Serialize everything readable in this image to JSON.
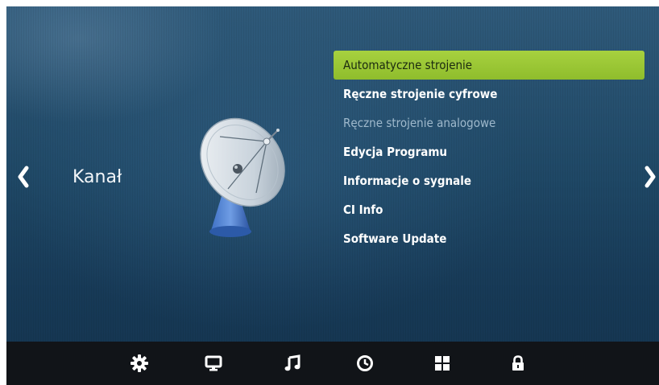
{
  "category": {
    "label": "Kanał"
  },
  "menu": {
    "items": [
      {
        "label": "Automatyczne strojenie",
        "state": "selected"
      },
      {
        "label": "Ręczne strojenie cyfrowe",
        "state": "normal"
      },
      {
        "label": "Ręczne strojenie analogowe",
        "state": "disabled"
      },
      {
        "label": "Edycja Programu",
        "state": "normal"
      },
      {
        "label": "Informacje o sygnale",
        "state": "normal"
      },
      {
        "label": "CI Info",
        "state": "normal"
      },
      {
        "label": "Software Update",
        "state": "normal"
      }
    ]
  },
  "bottom_tabs": [
    {
      "icon": "gear-icon",
      "active": true
    },
    {
      "icon": "monitor-icon",
      "active": false
    },
    {
      "icon": "music-icon",
      "active": false
    },
    {
      "icon": "clock-icon",
      "active": false
    },
    {
      "icon": "grid-icon",
      "active": false
    },
    {
      "icon": "lock-icon",
      "active": false
    }
  ],
  "colors": {
    "accent": "#9ac935",
    "background": "#1f4866",
    "bottom_bar": "#111418",
    "disabled_text": "#9fb9cc"
  },
  "icons": {
    "left_nav": "chevron-left-icon",
    "right_nav": "chevron-right-icon",
    "illustration": "satellite-dish-icon"
  }
}
